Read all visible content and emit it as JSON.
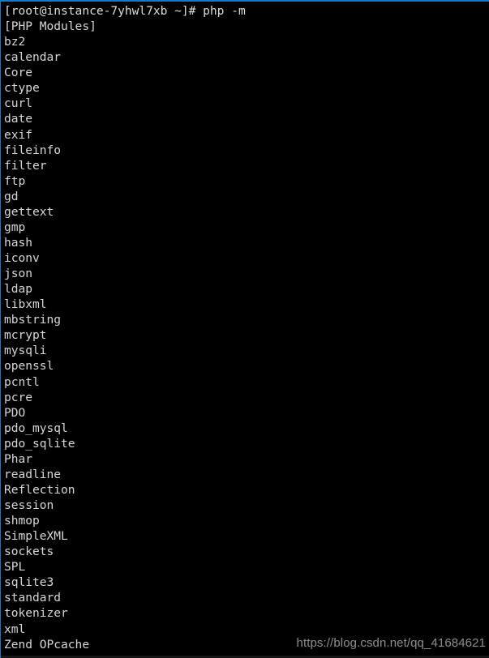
{
  "terminal": {
    "prompt": "[root@instance-7yhwl7xb ~]# php -m",
    "header": "[PHP Modules]",
    "lines": [
      "[root@instance-7yhwl7xb ~]# php -m",
      "[PHP Modules]",
      "bz2",
      "calendar",
      "Core",
      "ctype",
      "curl",
      "date",
      "exif",
      "fileinfo",
      "filter",
      "ftp",
      "gd",
      "gettext",
      "gmp",
      "hash",
      "iconv",
      "json",
      "ldap",
      "libxml",
      "mbstring",
      "mcrypt",
      "mysqli",
      "openssl",
      "pcntl",
      "pcre",
      "PDO",
      "pdo_mysql",
      "pdo_sqlite",
      "Phar",
      "readline",
      "Reflection",
      "session",
      "shmop",
      "SimpleXML",
      "sockets",
      "SPL",
      "sqlite3",
      "standard",
      "tokenizer",
      "xml",
      "Zend OPcache"
    ],
    "colors": {
      "background": "#000000",
      "foreground": "#d6d6d6",
      "border": "#1878c8",
      "watermark": "#8e8e8e"
    }
  },
  "watermark": {
    "text": "https://blog.csdn.net/qq_41684621"
  }
}
